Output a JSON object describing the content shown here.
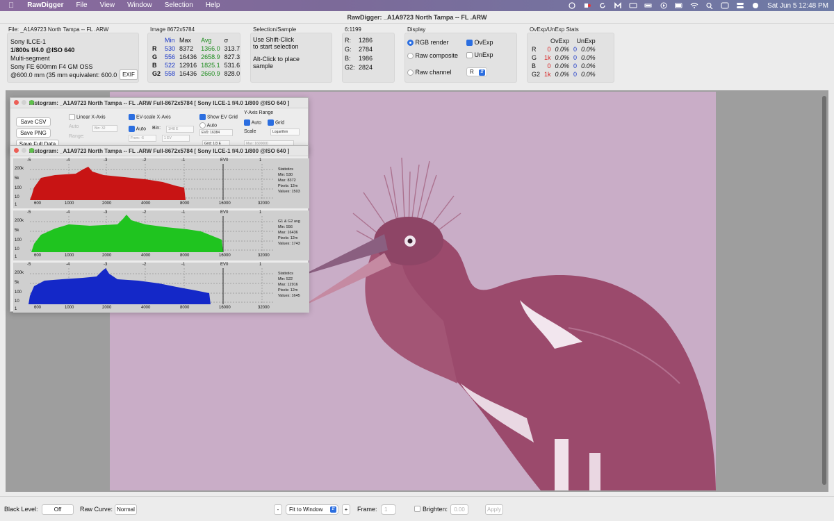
{
  "menubar": {
    "app_name": "RawDigger",
    "items": [
      "File",
      "View",
      "Window",
      "Selection",
      "Help"
    ],
    "datetime": "Sat Jun 5  12:48 PM"
  },
  "window_title": "RawDigger: _A1A9723 North Tampa -- FL .ARW",
  "file_panel": {
    "label": "File: _A1A9723 North Tampa -- FL .ARW",
    "camera": "Sony ILCE-1",
    "exposure": "1/800s f/4.0 @ISO 640",
    "mode": "Multi-segment",
    "lens": "Sony FE 600mm F4 GM OSS",
    "focal": "@600.0 mm (35 mm equivalent: 600.0",
    "exif_button": "EXIF"
  },
  "image_panel": {
    "label": "Image 8672x5784",
    "headers": [
      "",
      "Min",
      "Max",
      "Avg",
      "σ"
    ],
    "rows": [
      {
        "ch": "R",
        "min": "530",
        "max": "8372",
        "avg": "1366.0",
        "sd": "313.7"
      },
      {
        "ch": "G",
        "min": "556",
        "max": "16436",
        "avg": "2658.9",
        "sd": "827.3"
      },
      {
        "ch": "B",
        "min": "522",
        "max": "12916",
        "avg": "1825.1",
        "sd": "531.6"
      },
      {
        "ch": "G2",
        "min": "558",
        "max": "16436",
        "avg": "2660.9",
        "sd": "828.0"
      }
    ]
  },
  "selection_panel": {
    "label": "Selection/Sample",
    "line1": "Use Shift-Click",
    "line2": "to start selection",
    "line3": "Alt-Click to place",
    "line4": "sample"
  },
  "pixel_panel": {
    "label": "6:1199",
    "values": [
      {
        "ch": "R:",
        "val": "1286"
      },
      {
        "ch": "G:",
        "val": "2784"
      },
      {
        "ch": "B:",
        "val": "1986"
      },
      {
        "ch": "G2:",
        "val": "2824"
      }
    ]
  },
  "display_panel": {
    "label": "Display",
    "rgb_render": "RGB render",
    "raw_composite": "Raw composite",
    "raw_channel": "Raw channel",
    "ovexp": "OvExp",
    "unexp": "UnExp",
    "channel_value": "R"
  },
  "ovexp_panel": {
    "label": "OvExp/UnExp Stats",
    "headers": [
      "OvExp",
      "UnExp"
    ],
    "rows": [
      {
        "ch": "R",
        "ov_n": "0",
        "ov_p": "0.0%",
        "un_n": "0",
        "un_p": "0.0%"
      },
      {
        "ch": "G",
        "ov_n": "1k",
        "ov_p": "0.0%",
        "un_n": "0",
        "un_p": "0.0%"
      },
      {
        "ch": "B",
        "ov_n": "0",
        "ov_p": "0.0%",
        "un_n": "0",
        "un_p": "0.0%"
      },
      {
        "ch": "G2",
        "ov_n": "1k",
        "ov_p": "0.0%",
        "un_n": "0",
        "un_p": "0.0%"
      }
    ]
  },
  "hist_back": {
    "title": "Histogram: _A1A9723 North Tampa -- FL .ARW Full-8672x5784 [ Sony ILCE-1 f/4.0 1/800 @ISO 640 ]",
    "save_csv": "Save CSV",
    "save_png": "Save PNG",
    "save_full": "Save Full Data",
    "linear_x": "Linear X-Axis",
    "auto": "Auto",
    "bin_small": "Bin: 32",
    "range": "Range:",
    "ev_scale": "EV-scale X-Axis",
    "bin": "Bin:",
    "bin_val": "1/48 E",
    "from": "From: -6",
    "to": "1 EV",
    "show_ev": "Show EV Grid",
    "ev0": "EV0: 16384",
    "grid": "Grid: 1/3 E",
    "y_range": "Y-Axis Range",
    "grid_label": "Grid",
    "scale": "Scale",
    "scale_val": "Logarithm",
    "max": "Max: 1600000"
  },
  "hist_front": {
    "title": "Histogram: _A1A9723 North Tampa -- FL .ARW Full-8672x5784 [ Sony ILCE-1 f/4.0 1/800 @ISO 640 ]",
    "ev_ticks": [
      "-5",
      "-4",
      "-3",
      "-2",
      "-1",
      "EV0",
      "1"
    ],
    "x_ticks": [
      "600",
      "1000",
      "2000",
      "4000",
      "8000",
      "16000",
      "32000"
    ],
    "y_ticks": [
      "200k",
      "5k",
      "100",
      "10",
      "1"
    ],
    "channels": [
      {
        "name": "R",
        "stats_title": "Statistics",
        "min": "Min: 530",
        "max": "Max: 8372",
        "pixels": "Pixels: 12m",
        "values": "Values: 1503"
      },
      {
        "name": "G",
        "stats_title": "G1 & G2 avg",
        "min": "Min: 556",
        "max": "Max: 16436",
        "pixels": "Pixels: 12m",
        "values": "Values: 1743"
      },
      {
        "name": "B",
        "stats_title": "Statistics",
        "min": "Min: 522",
        "max": "Max: 12916",
        "pixels": "Pixels: 12m",
        "values": "Values: 1645"
      }
    ]
  },
  "bottom": {
    "black_level_label": "Black Level:",
    "black_level_value": "Off",
    "raw_curve_label": "Raw Curve:",
    "raw_curve_value": "Normal",
    "minus": "-",
    "zoom": "Fit to Window",
    "plus": "+",
    "frame_label": "Frame:",
    "frame_value": "1",
    "brighten_label": "Brighten:",
    "brighten_value": "0.00",
    "apply": "Apply"
  },
  "colors": {
    "red_hist": "#c81414",
    "green_hist": "#1fc41f",
    "blue_hist": "#1428c8",
    "photo_bg": "#c9adc7",
    "bird_body": "#9b4a6c"
  }
}
